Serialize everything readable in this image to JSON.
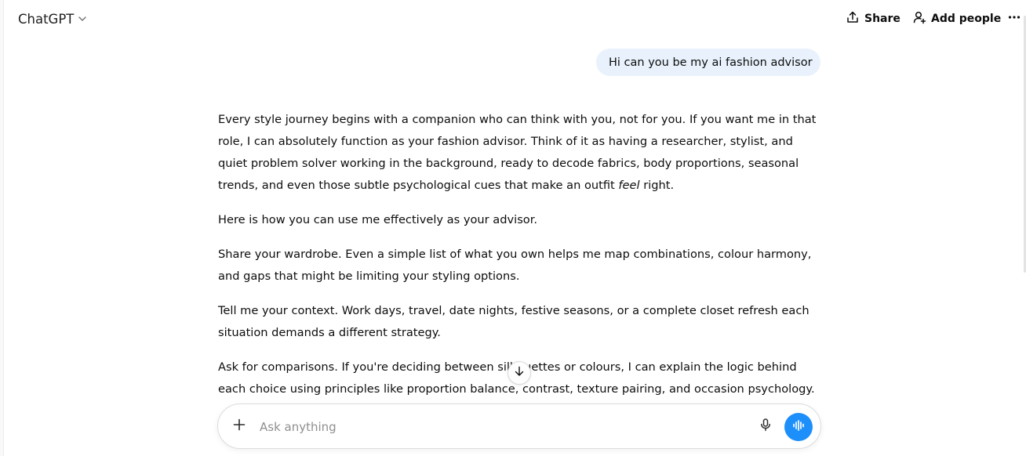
{
  "header": {
    "model_label": "ChatGPT",
    "share_label": "Share",
    "add_people_label": "Add people"
  },
  "conversation": {
    "user_message": "Hi can you be my ai fashion advisor",
    "assistant": {
      "p1_before_em": "Every style journey begins with a companion who can think with you, not for you. If you want me in that role, I can absolutely function as your fashion advisor. Think of it as having a researcher, stylist, and quiet problem solver working in the background, ready to decode fabrics, body proportions, seasonal trends, and even those subtle psychological cues that make an outfit ",
      "p1_em": "feel",
      "p1_after_em": " right.",
      "p2": "Here is how you can use me effectively as your advisor.",
      "p3": "Share your wardrobe. Even a simple list of what you own helps me map combinations, colour harmony, and gaps that might be limiting your styling options.",
      "p4": "Tell me your context. Work days, travel, date nights, festive seasons, or a complete closet refresh each situation demands a different strategy.",
      "p5": "Ask for comparisons. If you're deciding between silhouettes or colours, I can explain the logic behind each choice using principles like proportion balance, contrast, texture pairing, and occasion psychology."
    }
  },
  "composer": {
    "placeholder": "Ask anything",
    "value": ""
  },
  "icons": {
    "chevron": "chevron-down-icon",
    "share": "share-icon",
    "add_people": "add-person-icon",
    "more": "more-horizontal-icon",
    "scroll": "arrow-down-icon",
    "plus": "plus-icon",
    "mic": "microphone-icon",
    "voice": "voice-mode-icon"
  },
  "colors": {
    "user_bubble": "#e9f2fc",
    "voice_button": "#1d8ffb",
    "text": "#0d0d0d",
    "placeholder": "#8f8f8f"
  }
}
